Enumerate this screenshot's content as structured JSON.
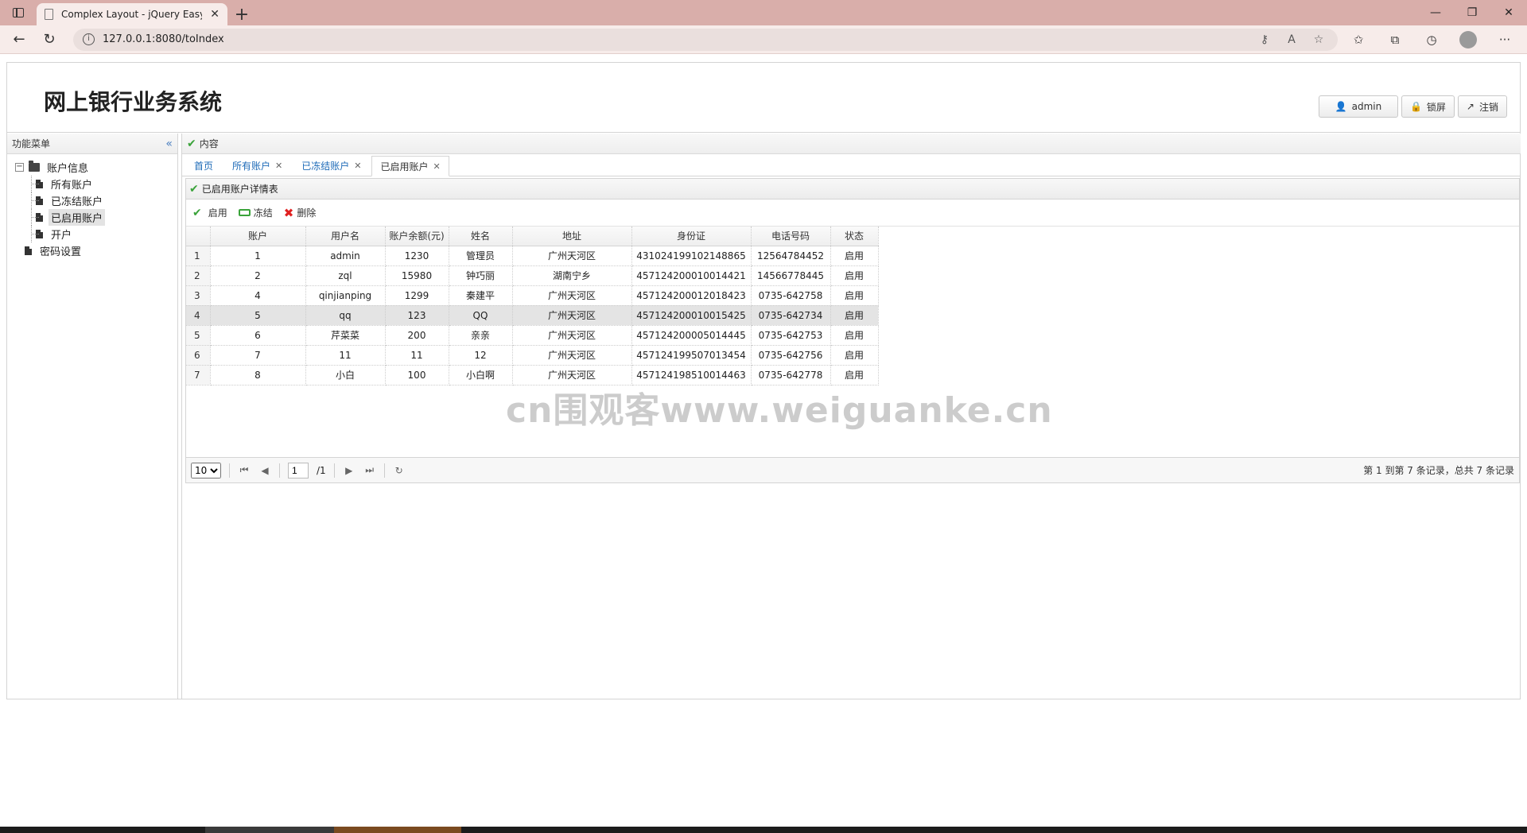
{
  "browser": {
    "tab_title": "Complex Layout - jQuery EasyUI",
    "url": "127.0.0.1:8080/toIndex"
  },
  "header": {
    "title": "网上银行业务系统",
    "buttons": {
      "user": "admin",
      "lock": "锁屏",
      "logout": "注销"
    }
  },
  "west": {
    "title": "功能菜单",
    "tree": {
      "root": "账户信息",
      "children": [
        "所有账户",
        "已冻结账户",
        "已启用账户",
        "开户"
      ],
      "root2": "密码设置"
    }
  },
  "center": {
    "title": "内容",
    "tabs": [
      "首页",
      "所有账户",
      "已冻结账户",
      "已启用账户"
    ],
    "grid_title": "已启用账户详情表",
    "toolbar": {
      "enable": "启用",
      "freeze": "冻结",
      "delete": "删除"
    },
    "columns": [
      "账户",
      "用户名",
      "账户余额(元)",
      "姓名",
      "地址",
      "身份证",
      "电话号码",
      "状态"
    ],
    "rows": [
      [
        "1",
        "1",
        "admin",
        "1230",
        "管理员",
        "广州天河区",
        "431024199102148865",
        "12564784452",
        "启用"
      ],
      [
        "2",
        "2",
        "zql",
        "15980",
        "钟巧丽",
        "湖南宁乡",
        "457124200010014421",
        "14566778445",
        "启用"
      ],
      [
        "3",
        "4",
        "qinjianping",
        "1299",
        "秦建平",
        "广州天河区",
        "457124200012018423",
        "0735-642758",
        "启用"
      ],
      [
        "4",
        "5",
        "qq",
        "123",
        "QQ",
        "广州天河区",
        "457124200010015425",
        "0735-642734",
        "启用"
      ],
      [
        "5",
        "6",
        "芹菜菜",
        "200",
        "亲亲",
        "广州天河区",
        "457124200005014445",
        "0735-642753",
        "启用"
      ],
      [
        "6",
        "7",
        "11",
        "11",
        "12",
        "广州天河区",
        "457124199507013454",
        "0735-642756",
        "启用"
      ],
      [
        "7",
        "8",
        "小白",
        "100",
        "小白啊",
        "广州天河区",
        "457124198510014463",
        "0735-642778",
        "启用"
      ]
    ],
    "pager": {
      "page_size": "10",
      "page": "1",
      "total_pages": "/1",
      "info": "第 1 到第 7 条记录，总共 7 条记录"
    }
  },
  "watermark": "cn围观客www.weiguanke.cn"
}
